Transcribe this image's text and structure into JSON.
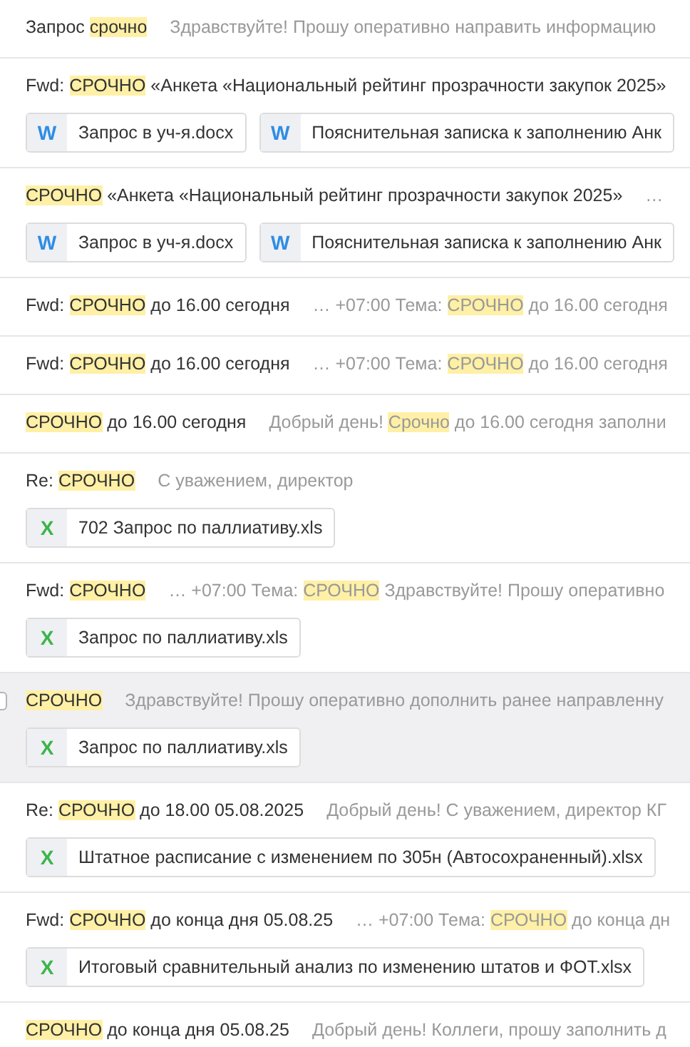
{
  "messages": [
    {
      "hovered": false,
      "subject": [
        {
          "text": "Запрос ",
          "highlight": false
        },
        {
          "text": "срочно",
          "highlight": true
        }
      ],
      "snippet": [
        {
          "text": "Здравствуйте! Прошу оперативно направить информацию",
          "highlight": false
        }
      ]
    },
    {
      "hovered": false,
      "subject": [
        {
          "text": "Fwd: ",
          "highlight": false
        },
        {
          "text": "СРОЧНО",
          "highlight": true
        },
        {
          "text": " «Анкета «Национальный рейтинг прозрачности закупок 2025»",
          "highlight": false
        }
      ],
      "attachments": [
        {
          "kind": "word",
          "badge": "W",
          "name": "Запрос в уч-я.docx"
        },
        {
          "kind": "word",
          "badge": "W",
          "name": "Пояснительная записка к заполнению Анк"
        }
      ]
    },
    {
      "hovered": false,
      "subject": [
        {
          "text": "СРОЧНО",
          "highlight": true
        },
        {
          "text": " «Анкета «Национальный рейтинг прозрачности закупок 2025»",
          "highlight": false
        }
      ],
      "snippet": [
        {
          "text": "…",
          "highlight": false
        }
      ],
      "attachments": [
        {
          "kind": "word",
          "badge": "W",
          "name": "Запрос в уч-я.docx"
        },
        {
          "kind": "word",
          "badge": "W",
          "name": "Пояснительная записка к заполнению Анк"
        }
      ]
    },
    {
      "hovered": false,
      "subject": [
        {
          "text": "Fwd: ",
          "highlight": false
        },
        {
          "text": "СРОЧНО",
          "highlight": true
        },
        {
          "text": " до 16.00 сегодня",
          "highlight": false
        }
      ],
      "snippet": [
        {
          "text": "… +07:00 Тема: ",
          "highlight": false
        },
        {
          "text": "СРОЧНО",
          "highlight": true
        },
        {
          "text": " до 16.00 сегодня",
          "highlight": false
        }
      ]
    },
    {
      "hovered": false,
      "subject": [
        {
          "text": "Fwd: ",
          "highlight": false
        },
        {
          "text": "СРОЧНО",
          "highlight": true
        },
        {
          "text": " до 16.00 сегодня",
          "highlight": false
        }
      ],
      "snippet": [
        {
          "text": "… +07:00 Тема: ",
          "highlight": false
        },
        {
          "text": "СРОЧНО",
          "highlight": true
        },
        {
          "text": " до 16.00 сегодня",
          "highlight": false
        }
      ]
    },
    {
      "hovered": false,
      "subject": [
        {
          "text": "СРОЧНО",
          "highlight": true
        },
        {
          "text": " до 16.00 сегодня",
          "highlight": false
        }
      ],
      "snippet": [
        {
          "text": "Добрый день! ",
          "highlight": false
        },
        {
          "text": "Срочно",
          "highlight": true
        },
        {
          "text": " до 16.00 сегодня заполни",
          "highlight": false
        }
      ]
    },
    {
      "hovered": false,
      "subject": [
        {
          "text": "Re: ",
          "highlight": false
        },
        {
          "text": "СРОЧНО",
          "highlight": true
        }
      ],
      "snippet": [
        {
          "text": "С уважением, директор",
          "highlight": false
        }
      ],
      "attachments": [
        {
          "kind": "excel",
          "badge": "X",
          "name": "702 Запрос по паллиативу.xls"
        }
      ]
    },
    {
      "hovered": false,
      "subject": [
        {
          "text": "Fwd: ",
          "highlight": false
        },
        {
          "text": "СРОЧНО",
          "highlight": true
        }
      ],
      "snippet": [
        {
          "text": "… +07:00 Тема: ",
          "highlight": false
        },
        {
          "text": "СРОЧНО",
          "highlight": true
        },
        {
          "text": " Здравствуйте! Прошу оперативно",
          "highlight": false
        }
      ],
      "attachments": [
        {
          "kind": "excel",
          "badge": "X",
          "name": "Запрос по паллиативу.xls"
        }
      ]
    },
    {
      "hovered": true,
      "subject": [
        {
          "text": "СРОЧНО",
          "highlight": true
        }
      ],
      "snippet": [
        {
          "text": "Здравствуйте! Прошу оперативно дополнить ранее направленну",
          "highlight": false
        }
      ],
      "attachments": [
        {
          "kind": "excel",
          "badge": "X",
          "name": "Запрос по паллиативу.xls"
        }
      ]
    },
    {
      "hovered": false,
      "subject": [
        {
          "text": "Re: ",
          "highlight": false
        },
        {
          "text": "СРОЧНО",
          "highlight": true
        },
        {
          "text": " до 18.00 05.08.2025",
          "highlight": false
        }
      ],
      "snippet": [
        {
          "text": "Добрый день! С уважением, директор КГ",
          "highlight": false
        }
      ],
      "attachments": [
        {
          "kind": "excel",
          "badge": "X",
          "name": "Штатное расписание с изменением по 305н (Автосохраненный).xlsx"
        }
      ]
    },
    {
      "hovered": false,
      "subject": [
        {
          "text": "Fwd: ",
          "highlight": false
        },
        {
          "text": "СРОЧНО",
          "highlight": true
        },
        {
          "text": " до конца дня 05.08.25",
          "highlight": false
        }
      ],
      "snippet": [
        {
          "text": "… +07:00 Тема: ",
          "highlight": false
        },
        {
          "text": "СРОЧНО",
          "highlight": true
        },
        {
          "text": " до конца дн",
          "highlight": false
        }
      ],
      "attachments": [
        {
          "kind": "excel",
          "badge": "X",
          "name": "Итоговый сравнительный анализ по изменению штатов и ФОТ.xlsx"
        }
      ]
    },
    {
      "hovered": false,
      "subject": [
        {
          "text": "СРОЧНО",
          "highlight": true
        },
        {
          "text": " до конца дня 05.08.25",
          "highlight": false
        }
      ],
      "snippet": [
        {
          "text": "Добрый день! Коллеги, прошу заполнить д",
          "highlight": false
        }
      ]
    }
  ]
}
